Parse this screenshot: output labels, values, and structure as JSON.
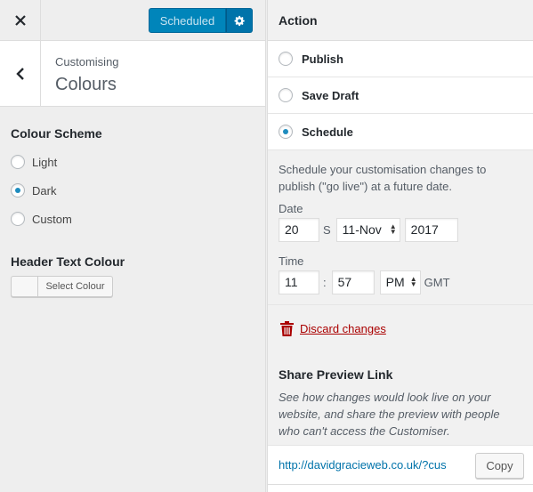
{
  "header": {
    "close_icon": "close-icon",
    "publish_state_label": "Scheduled",
    "settings_icon": "gear-icon"
  },
  "section": {
    "subtitle": "Customising",
    "title": "Colours",
    "back_icon": "chevron-left-icon"
  },
  "colour_scheme": {
    "title": "Colour Scheme",
    "options": [
      {
        "label": "Light",
        "selected": false
      },
      {
        "label": "Dark",
        "selected": true
      },
      {
        "label": "Custom",
        "selected": false
      }
    ]
  },
  "header_text_colour": {
    "title": "Header Text Colour",
    "button_label": "Select Colour"
  },
  "action_panel": {
    "title": "Action",
    "options": [
      {
        "label": "Publish",
        "selected": false
      },
      {
        "label": "Save Draft",
        "selected": false
      },
      {
        "label": "Schedule",
        "selected": true
      }
    ],
    "schedule_description": "Schedule your customisation changes to publish (\"go live\") at a future date.",
    "date_label": "Date",
    "date_day": "20",
    "date_sep": "S",
    "date_month": "11-Nov",
    "date_year": "2017",
    "time_label": "Time",
    "time_hour": "11",
    "time_sep": ":",
    "time_minute": "57",
    "time_ampm": "PM",
    "timezone": "GMT",
    "discard_label": "Discard changes",
    "discard_icon": "trash-icon"
  },
  "share_preview": {
    "title": "Share Preview Link",
    "description": "See how changes would look live on your website, and share the preview with people who can't access the Customiser.",
    "url": "http://davidgracieweb.co.uk/?cus",
    "copy_label": "Copy"
  },
  "colors": {
    "accent": "#0085ba",
    "discard": "#aa0000",
    "link": "#0073aa"
  }
}
